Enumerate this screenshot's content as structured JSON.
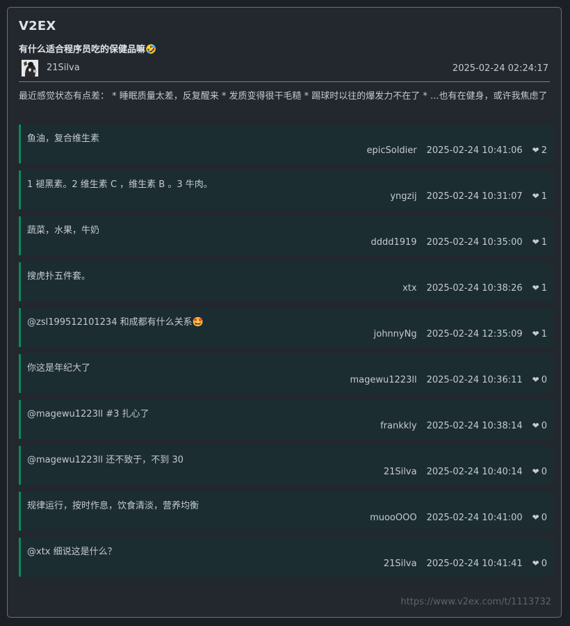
{
  "site": {
    "name": "V2EX"
  },
  "post": {
    "title": "有什么适合程序员吃的保健品嘛🤣",
    "author": "21Silva",
    "time": "2025-02-24 02:24:17",
    "body": "最近感觉状态有点差： * 睡眠质量太差，反复醒来 * 发质变得很干毛糙 * 踢球时以往的爆发力不在了 * ...也有在健身，或许我焦虑了"
  },
  "replies": [
    {
      "text": "鱼油，复合维生素",
      "user": "epicSoldier",
      "time": "2025-02-24 10:41:06",
      "likes": "2"
    },
    {
      "text": "1 褪黑素。2 维生素 C ，维生素 B 。3 牛肉。",
      "user": "yngzij",
      "time": "2025-02-24 10:31:07",
      "likes": "1"
    },
    {
      "text": "蔬菜，水果，牛奶",
      "user": "dddd1919",
      "time": "2025-02-24 10:35:00",
      "likes": "1"
    },
    {
      "text": "搜虎扑五件套。",
      "user": "xtx",
      "time": "2025-02-24 10:38:26",
      "likes": "1"
    },
    {
      "text": "@zsl199512101234 和成都有什么关系🤩",
      "user": "johnnyNg",
      "time": "2025-02-24 12:35:09",
      "likes": "1"
    },
    {
      "text": "你这是年纪大了",
      "user": "magewu1223ll",
      "time": "2025-02-24 10:36:11",
      "likes": "0"
    },
    {
      "text": "@magewu1223ll #3 扎心了",
      "user": "frankkly",
      "time": "2025-02-24 10:38:14",
      "likes": "0"
    },
    {
      "text": "@magewu1223ll 还不致于，不到 30",
      "user": "21Silva",
      "time": "2025-02-24 10:40:14",
      "likes": "0"
    },
    {
      "text": "规律运行，按时作息，饮食清淡，营养均衡",
      "user": "muooOOO",
      "time": "2025-02-24 10:41:00",
      "likes": "0"
    },
    {
      "text": "@xtx 细说这是什么？",
      "user": "21Silva",
      "time": "2025-02-24 10:41:41",
      "likes": "0"
    }
  ],
  "icons": {
    "heart": "heart-icon",
    "avatar": "avatar-image"
  },
  "colors": {
    "accent": "#0c8a5c",
    "reply_bg": "#1b2d31",
    "card_bg": "#23272e"
  },
  "footer": {
    "url": "https://www.v2ex.com/t/1113732"
  }
}
